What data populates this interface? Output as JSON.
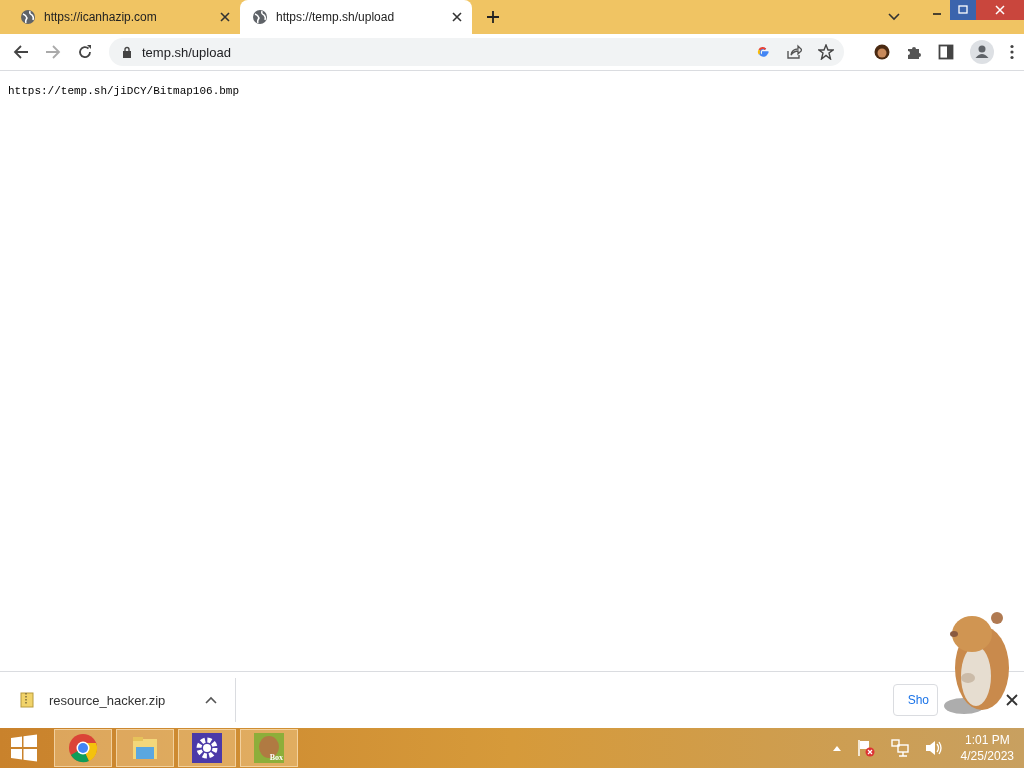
{
  "tabs": [
    {
      "title": "https://icanhazip.com",
      "selected": false
    },
    {
      "title": "https://temp.sh/upload",
      "selected": true
    }
  ],
  "window_controls": [
    {
      "kind": "minimize",
      "hovered": false
    },
    {
      "kind": "maximize",
      "hovered": true
    },
    {
      "kind": "close",
      "hovered": false
    }
  ],
  "address_bar": {
    "url": "temp.sh/upload"
  },
  "page": {
    "text": "https://temp.sh/jiDCY/Bitmap106.bmp"
  },
  "download_bar": {
    "items": [
      {
        "filename": "resource_hacker.zip"
      }
    ],
    "show_all_button": "Sho"
  },
  "taskbar": {
    "apps": [
      {
        "kind": "chrome"
      },
      {
        "kind": "explorer"
      },
      {
        "kind": "settings"
      },
      {
        "kind": "box",
        "label": "Box"
      }
    ],
    "clock": {
      "time": "1:01 PM",
      "date": "4/25/2023"
    }
  }
}
